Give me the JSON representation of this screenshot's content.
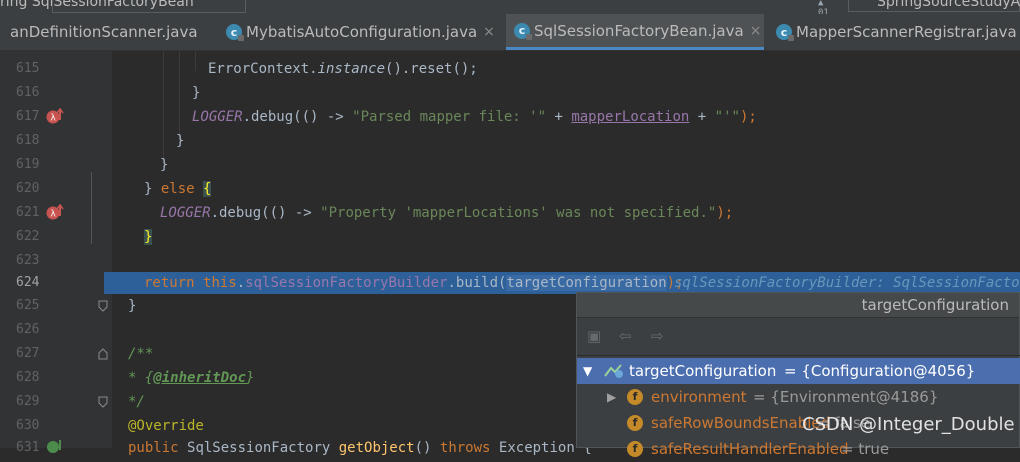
{
  "topbar": {
    "crumb_text": "ring   SqlSessionFactoryBean",
    "project_text": "SpringSourceStudyA"
  },
  "tabs": [
    {
      "label": "anDefinitionScanner.java"
    },
    {
      "label": "MybatisAutoConfiguration.java",
      "close": "×"
    },
    {
      "label": "SqlSessionFactoryBean.java",
      "close": "×"
    },
    {
      "label": "MapperScannerRegistrar.java"
    }
  ],
  "editor": {
    "lines": [
      {
        "num": "615"
      },
      {
        "num": "616"
      },
      {
        "num": "617"
      },
      {
        "num": "618"
      },
      {
        "num": "619"
      },
      {
        "num": "620"
      },
      {
        "num": "621"
      },
      {
        "num": "622"
      },
      {
        "num": "623"
      },
      {
        "num": "624"
      },
      {
        "num": "625"
      },
      {
        "num": "626"
      },
      {
        "num": "627"
      },
      {
        "num": "628"
      },
      {
        "num": "629"
      },
      {
        "num": "630"
      },
      {
        "num": "631"
      }
    ],
    "code": {
      "l615_a": "ErrorContext.",
      "l615_b": "instance",
      "l615_c": "().reset();",
      "l616": "}",
      "l617_a": "LOGGER",
      "l617_b": ".debug(() -> ",
      "l617_c": "\"Parsed mapper file: '\"",
      "l617_d": " + ",
      "l617_e": "mapperLocation",
      "l617_f": " + ",
      "l617_g": "\"'\"",
      "l617_h": ");",
      "l618": "}",
      "l619": "}",
      "l620_a": "} ",
      "l620_b": "else",
      "l620_c": "{",
      "l621_a": "LOGGER",
      "l621_b": ".debug(() -> ",
      "l621_c": "\"Property 'mapperLocations' was not specified.\"",
      "l621_d": ");",
      "l622": "}",
      "l624_a": "return ",
      "l624_b": "this",
      "l624_c": ".",
      "l624_d": "sqlSessionFactoryBuilder",
      "l624_e": ".build(",
      "l624_f": "targetConfiguration",
      "l624_g": ");",
      "l624_inline": "sqlSessionFactoryBuilder: SqlSessionFactoryB",
      "l625": "}",
      "l627": "/**",
      "l628_a": " * {",
      "l628_b": "@inheritDoc",
      "l628_c": "}",
      "l629": " */",
      "l630": "@Override",
      "l631_a": "public ",
      "l631_b": "SqlSessionFactory ",
      "l631_c": "getObject",
      "l631_d": "() ",
      "l631_e": "throws ",
      "l631_f": "Exception {"
    }
  },
  "popup": {
    "title": "targetConfiguration",
    "rows": [
      {
        "name": "targetConfiguration",
        "value": " = {Configuration@4056}"
      },
      {
        "name": "environment",
        "value": " = {Environment@4186}"
      },
      {
        "name": "safeRowBoundsEnabled",
        "value": " = false"
      },
      {
        "name": "safeResultHandlerEnabled",
        "value": " = true"
      }
    ]
  },
  "watermark": "CSDN @Integer_Double",
  "colors": {
    "background": "#2b2b2b",
    "gutter": "#313335",
    "execution_line": "#2d6099",
    "keyword": "#cc7832",
    "string": "#6a8759",
    "field": "#9876aa",
    "selected_row": "#4b6eaf",
    "breakpoint": "#c75450"
  },
  "icons": [
    "class-icon",
    "close-icon",
    "lambda-breakpoint-icon",
    "fold-icon",
    "restore-layout-icon",
    "back-icon",
    "forward-icon",
    "expand-arrow-icon",
    "field-icon"
  ]
}
